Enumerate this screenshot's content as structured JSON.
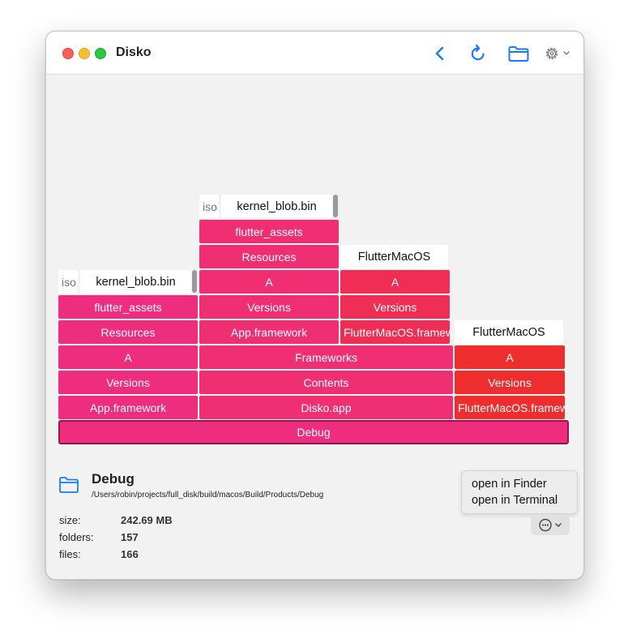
{
  "window": {
    "title": "Disko"
  },
  "toolbar": {
    "back_icon": "chevron-left-icon",
    "reload_icon": "reload-icon",
    "folder_icon": "folder-icon",
    "settings_icon": "gear-icon"
  },
  "chart": {
    "root": "Debug",
    "col1": {
      "app_framework": "App.framework",
      "versions": "Versions",
      "a": "A",
      "resources": "Resources",
      "flutter_assets": "flutter_assets",
      "iso": "iso",
      "kernel_blob": "kernel_blob.bin"
    },
    "col2": {
      "disko_app": "Disko.app",
      "contents": "Contents",
      "frameworks": "Frameworks",
      "app_framework": "App.framework",
      "versions": "Versions",
      "a": "A",
      "resources": "Resources",
      "flutter_assets": "flutter_assets",
      "iso": "iso",
      "kernel_blob": "kernel_blob.bin",
      "flutter_macos_framework": "FlutterMacOS.framework",
      "fm_versions": "Versions",
      "fm_a": "A",
      "fm_binary": "FlutterMacOS"
    },
    "col3": {
      "flutter_macos_framework": "FlutterMacOS.framework",
      "versions": "Versions",
      "a": "A",
      "binary": "FlutterMacOS"
    }
  },
  "selection": {
    "name": "Debug",
    "path": "/Users/robin/projects/full_disk/build/macos/Build/Products/Debug",
    "size_label": "size:",
    "size_value": "242.69 MB",
    "folders_label": "folders:",
    "folders_value": "157",
    "files_label": "files:",
    "files_value": "166"
  },
  "menu": {
    "open_finder": "open in Finder",
    "open_terminal": "open in Terminal"
  },
  "colors": {
    "accent": "#1a7cf5",
    "pink": "#ee2d7e",
    "red": "#ee2d2f"
  }
}
